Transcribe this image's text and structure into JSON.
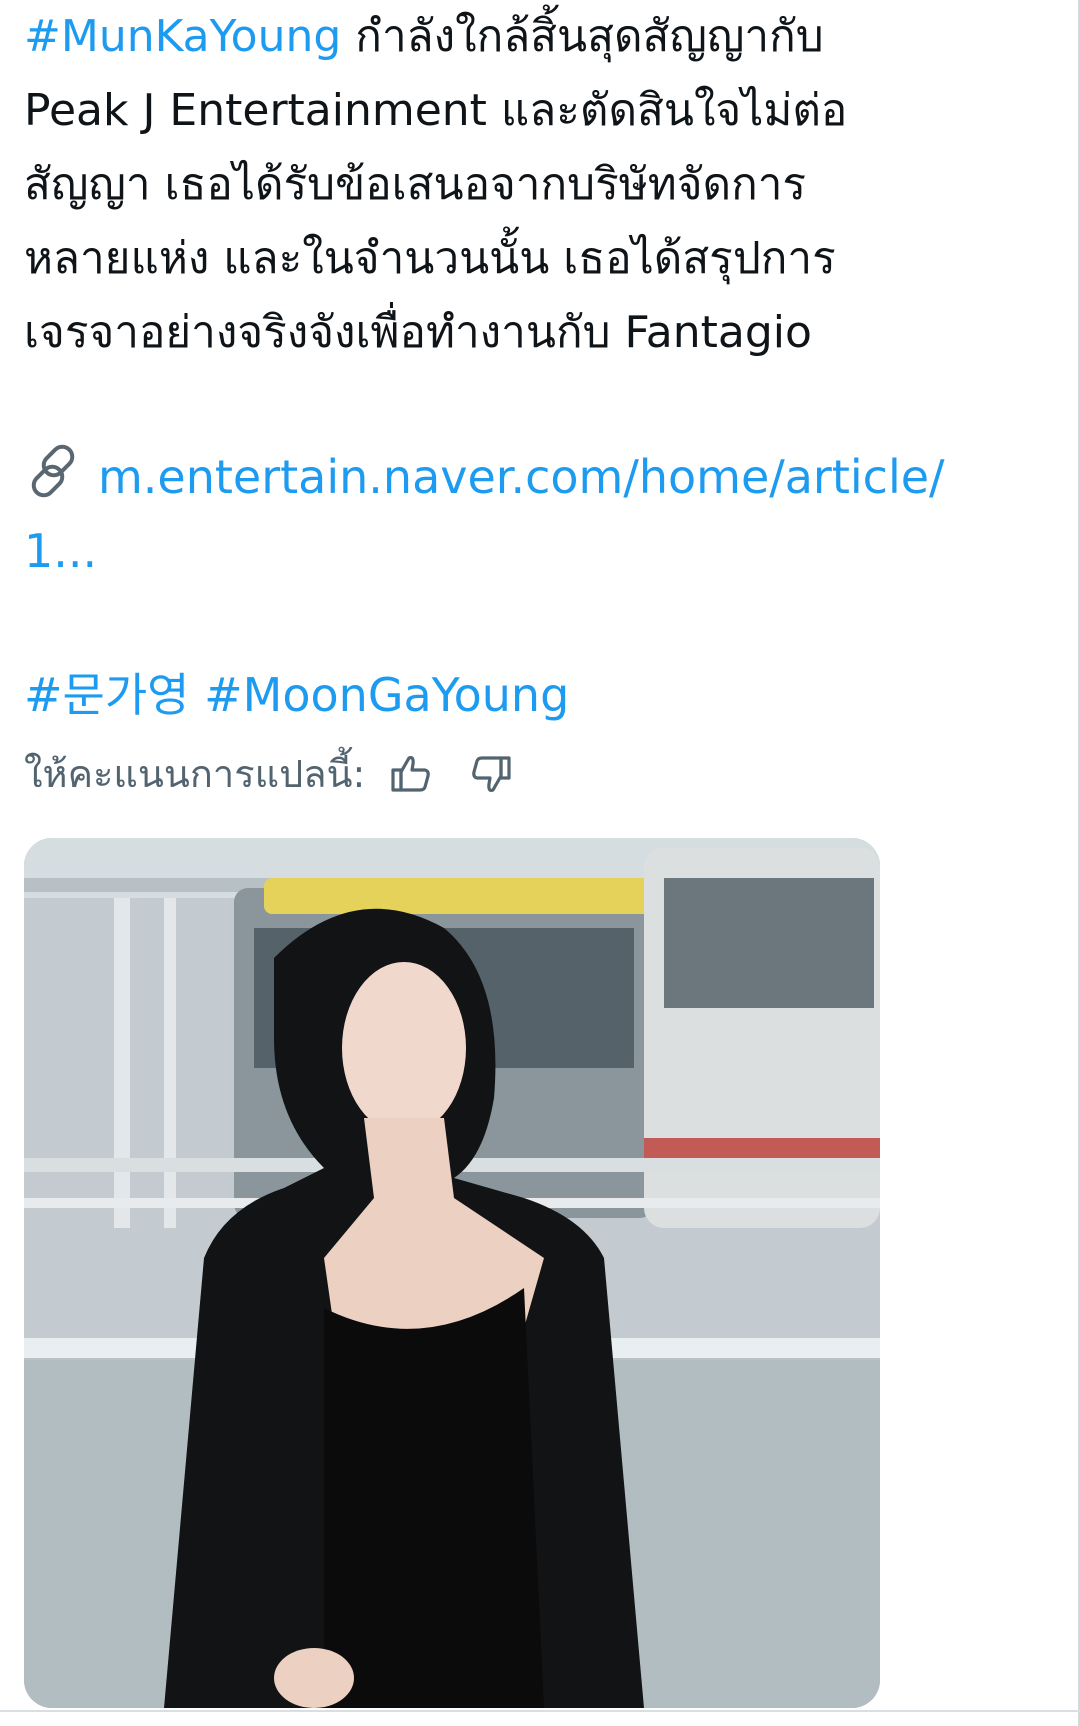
{
  "tweet": {
    "hashtag_main": "#MunKaYoung",
    "text_parts": [
      " กำลังใกล้สิ้นสุดสัญญากับ",
      "Peak J Entertainment และตัดสินใจไม่ต่อ",
      "สัญญา เธอได้รับข้อเสนอจากบริษัทจัดการ",
      "หลายแห่ง และในจำนวนนั้น เธอได้สรุปการ",
      "เจรจาอย่างจริงจังเพื่อทำงานกับ Fantagio"
    ],
    "link_line1": "m.entertain.naver.com/home/article/",
    "link_line2": "1...",
    "hashtags": [
      "#문가영",
      "#MoonGaYoung"
    ],
    "rate_label": "ให้คะแนนการแปลนี้:",
    "icons": {
      "link": "link-icon",
      "thumbs_up": "thumbs-up-icon",
      "thumbs_down": "thumbs-down-icon"
    },
    "colors": {
      "link": "#1d9bf0",
      "text": "#0f1419",
      "muted": "#536471"
    }
  }
}
